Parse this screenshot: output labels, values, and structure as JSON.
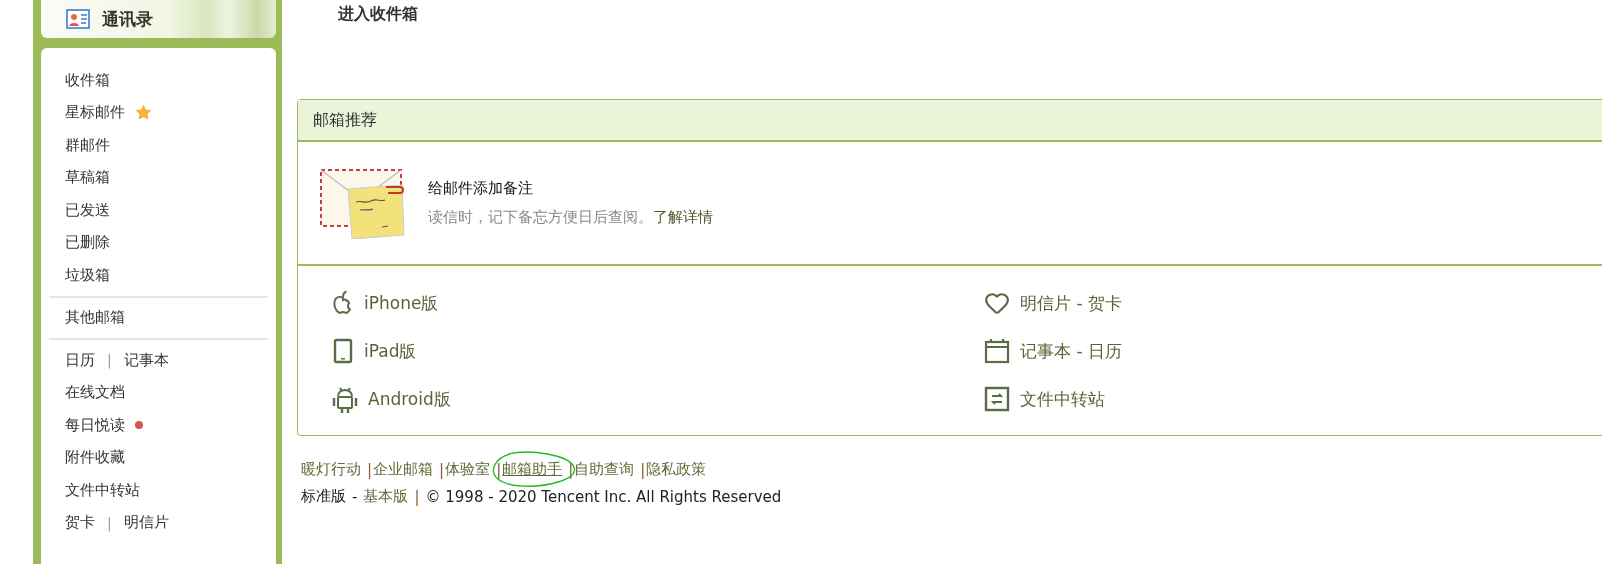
{
  "sidebar": {
    "contacts": {
      "label": "通讯录"
    },
    "groups": [
      {
        "items": [
          {
            "kind": "plain",
            "label": "收件箱"
          },
          {
            "kind": "star",
            "label": "星标邮件"
          },
          {
            "kind": "plain",
            "label": "群邮件"
          },
          {
            "kind": "plain",
            "label": "草稿箱"
          },
          {
            "kind": "plain",
            "label": "已发送"
          },
          {
            "kind": "plain",
            "label": "已删除"
          },
          {
            "kind": "plain",
            "label": "垃圾箱"
          }
        ]
      },
      {
        "items": [
          {
            "kind": "plain",
            "label": "其他邮箱"
          }
        ]
      },
      {
        "items": [
          {
            "kind": "pair",
            "links": [
              "日历",
              "记事本"
            ],
            "separator": "|"
          },
          {
            "kind": "plain",
            "label": "在线文档"
          },
          {
            "kind": "dot",
            "label": "每日悦读",
            "color": "#d9534f"
          },
          {
            "kind": "plain",
            "label": "附件收藏"
          },
          {
            "kind": "plain",
            "label": "文件中转站"
          },
          {
            "kind": "pair",
            "links": [
              "贺卡",
              "明信片"
            ],
            "separator": "|"
          }
        ]
      }
    ]
  },
  "main": {
    "title": "进入收件箱",
    "panel": {
      "header": "邮箱推荐",
      "feature": {
        "title": "给邮件添加备注",
        "description": "读信时，记下备忘方便日后查阅。",
        "link": "了解详情"
      },
      "apps": [
        {
          "kind": "apple",
          "label": "iPhone版"
        },
        {
          "kind": "heart",
          "label": "明信片 - 贺卡"
        },
        {
          "kind": "tablet",
          "label": "iPad版"
        },
        {
          "kind": "calendar",
          "label": "记事本 - 日历"
        },
        {
          "kind": "android",
          "label": "Android版"
        },
        {
          "kind": "transfer",
          "label": "文件中转站"
        }
      ]
    },
    "footer": {
      "links": [
        {
          "label": "暖灯行动",
          "underlined": false,
          "circled": false
        },
        {
          "label": "企业邮箱",
          "underlined": false,
          "circled": false
        },
        {
          "label": "体验室",
          "underlined": false,
          "circled": false
        },
        {
          "label": "邮箱助手",
          "underlined": true,
          "circled": true
        },
        {
          "label": "自助查询",
          "underlined": false,
          "circled": false
        },
        {
          "label": "隐私政策",
          "underlined": false,
          "circled": false
        }
      ],
      "separator": "|",
      "edition": "标准版",
      "dash": "-",
      "basic_link": "基本版",
      "divider": "|",
      "copyright": "© 1998 - 2020 Tencent Inc. All Rights Reserved"
    }
  }
}
